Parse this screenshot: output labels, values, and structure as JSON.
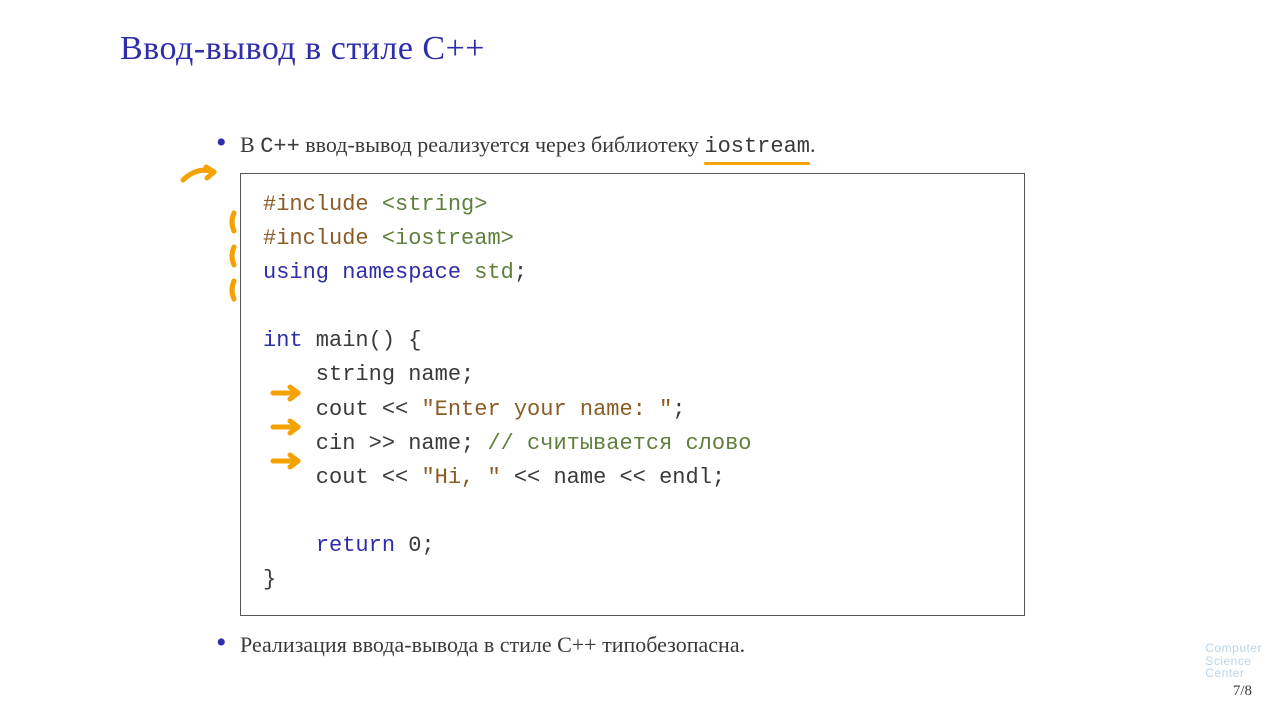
{
  "title": "Ввод-вывод в стиле C++",
  "bullets": {
    "b1_pre": "В ",
    "b1_cpp": "C++",
    "b1_mid": " ввод-вывод реализуется через библиотеку ",
    "b1_lib": "iostream",
    "b1_end": ".",
    "b2": "Реализация ввода-вывода в стиле C++ типобезопасна."
  },
  "code": {
    "l1_a": "#include",
    "l1_b": " <string>",
    "l2_a": "#include",
    "l2_b": " <iostream>",
    "l3_a": "using",
    "l3_b": " namespace",
    "l3_c": " std",
    "l3_d": ";",
    "blank1": "",
    "l5_a": "int",
    "l5_b": " main() {",
    "l6": "    string name;",
    "l7_a": "    cout << ",
    "l7_b": "\"Enter your name: \"",
    "l7_c": ";",
    "l8_a": "    cin >> name; ",
    "l8_b": "// считывается слово",
    "l9_a": "    cout << ",
    "l9_b": "\"Hi, \"",
    "l9_c": " << name << endl;",
    "blank2": "",
    "l11_a": "    ",
    "l11_b": "return",
    "l11_c": " 0;",
    "l12": "}"
  },
  "page": "7/8",
  "logo": {
    "l1": "Computer",
    "l2": "Science",
    "l3": "Center"
  }
}
